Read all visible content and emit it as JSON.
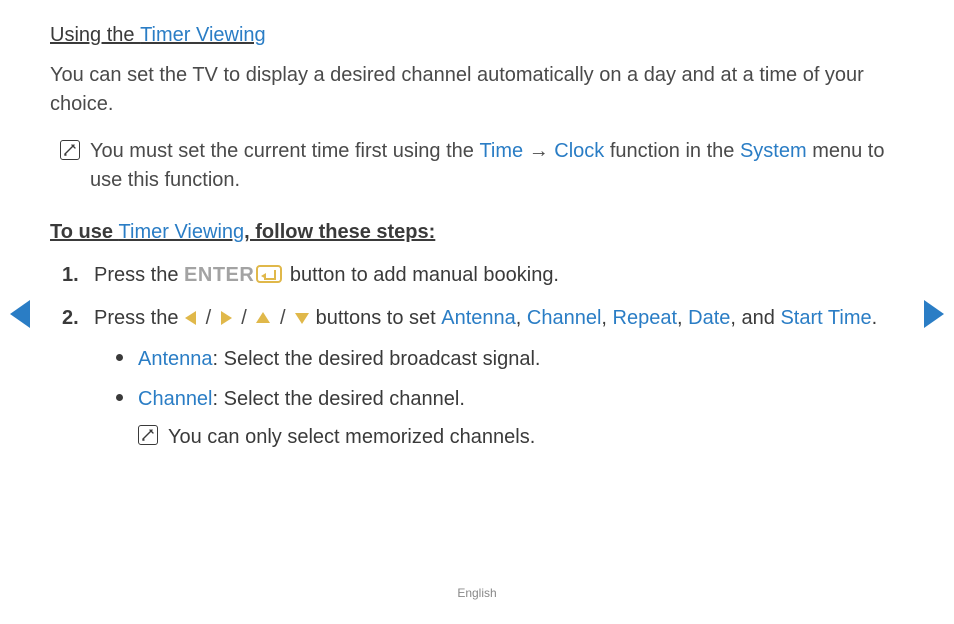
{
  "heading": {
    "prefix": "Using the ",
    "link": "Timer Viewing"
  },
  "intro": "You can set the TV to display a desired channel automatically on a day and at a time of your choice.",
  "note1": {
    "pre": "You must set the current time first using the ",
    "time": "Time",
    "arrow": " → ",
    "clock": "Clock",
    "mid": " function in the ",
    "system": "System",
    "post": " menu to use this function."
  },
  "subheading": {
    "pre": "To use ",
    "link": "Timer Viewing",
    "post": ", follow these steps:"
  },
  "steps": {
    "one_num": "1.",
    "one_pre": "Press the ",
    "one_enter": "ENTER",
    "one_post": " button to add manual booking.",
    "two_num": "2.",
    "two_pre": "Press the ",
    "two_mid": " buttons to set ",
    "antenna": "Antenna",
    "channel": "Channel",
    "repeat": "Repeat",
    "date": "Date",
    "and": ", and ",
    "starttime": "Start Time",
    "period": ".",
    "comma": ", "
  },
  "bullets": {
    "antenna_label": "Antenna",
    "antenna_text": ": Select the desired broadcast signal.",
    "channel_label": "Channel",
    "channel_text": ": Select the desired channel.",
    "channel_note": "You can only select memorized channels."
  },
  "slash": " / ",
  "footer": "English"
}
